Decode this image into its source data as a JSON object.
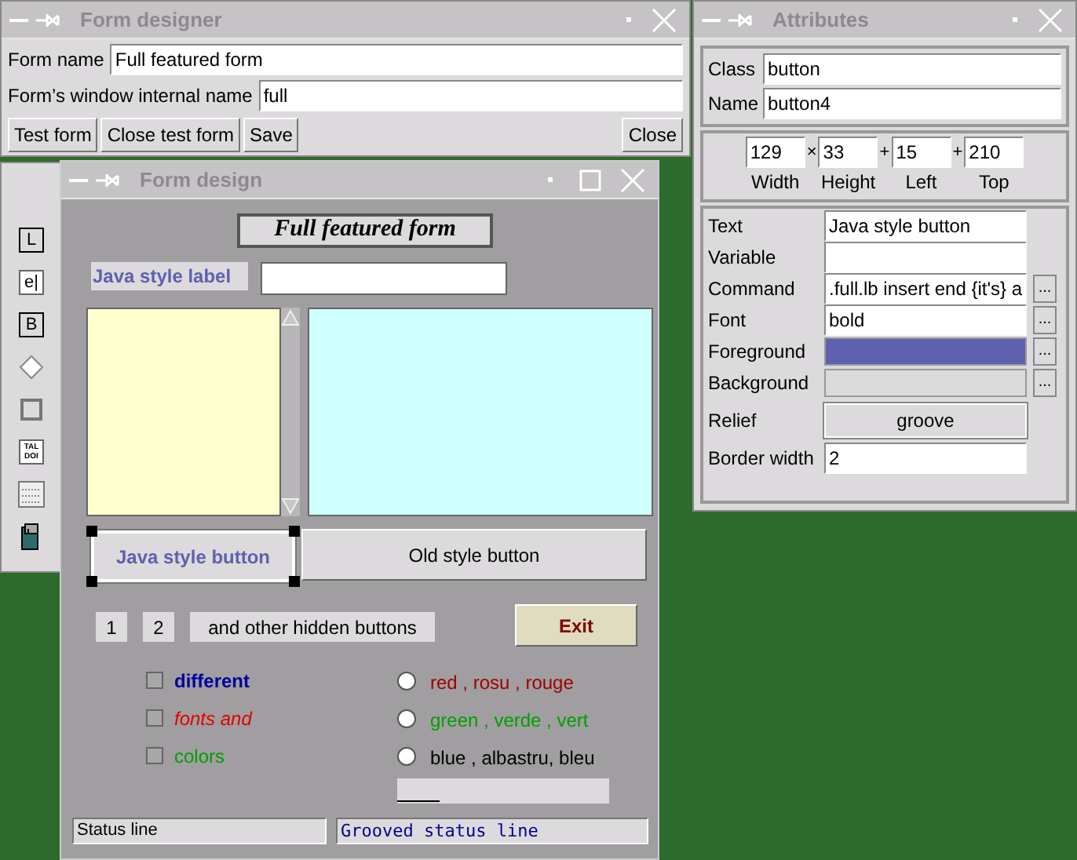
{
  "form_designer": {
    "title": "Form designer",
    "fields": [
      {
        "label": "Form name",
        "value": "Full featured form"
      },
      {
        "label": "Form’s window internal name",
        "value": "full"
      }
    ],
    "buttons": [
      "Test form",
      "Close test form",
      "Save"
    ],
    "close_button": "Close"
  },
  "attributes": {
    "title": "Attributes",
    "identity": [
      {
        "label": "Class",
        "value": "button"
      },
      {
        "label": "Name",
        "value": "button4"
      }
    ],
    "geometry": [
      {
        "value": "129",
        "label": "Width"
      },
      {
        "sep": "×",
        "value": "33",
        "label": "Height"
      },
      {
        "sep": "+",
        "value": "15",
        "label": "Left"
      },
      {
        "sep": "+",
        "value": "210",
        "label": "Top"
      }
    ],
    "properties": [
      {
        "kind": "entry",
        "label": "Text",
        "value": "Java style button"
      },
      {
        "kind": "entry",
        "label": "Variable"
      },
      {
        "kind": "entry",
        "label": "Command",
        "value": ".full.lb insert end {it's} a",
        "more": "..."
      },
      {
        "kind": "entry",
        "label": "Font",
        "value": "bold",
        "more": "..."
      },
      {
        "kind": "color",
        "label": "Foreground",
        "color": "#6060b0",
        "more": "..."
      },
      {
        "kind": "color",
        "label": "Background",
        "color": "#dcdadc",
        "more": "..."
      },
      {
        "kind": "menu",
        "label": "Relief",
        "value": "groove"
      },
      {
        "kind": "entry",
        "label": "Border width",
        "value": "2"
      }
    ]
  },
  "toolbox": {
    "items": [
      {
        "kind": "label",
        "glyph": "L"
      },
      {
        "kind": "entry",
        "glyph": "e|"
      },
      {
        "kind": "button",
        "glyph": "B"
      },
      {
        "kind": "radio"
      },
      {
        "kind": "checkbox"
      },
      {
        "kind": "text",
        "glyph": "TAL DOI"
      },
      {
        "kind": "listbox"
      },
      {
        "kind": "image"
      }
    ]
  },
  "form_design": {
    "title": "Form design",
    "heading": "Full featured form",
    "java_label": "Java style label",
    "java_button": {
      "label": "Java style button",
      "selected": true
    },
    "old_button": "Old style button",
    "small_buttons": [
      "1",
      "2",
      "and other hidden buttons"
    ],
    "exit_button": "Exit",
    "checkboxes": [
      {
        "label": "different",
        "checked": false,
        "color": "#0000a0",
        "kind": "bold"
      },
      {
        "label": "fonts and",
        "checked": false,
        "color": "#e00000",
        "kind": "italic"
      },
      {
        "label": "colors",
        "checked": false,
        "color": "#00a000",
        "kind": "plain"
      }
    ],
    "radios": [
      {
        "label": "red , rosu , rouge",
        "selected": false,
        "color": "#a00000"
      },
      {
        "label": "green , verde , vert",
        "selected": false,
        "color": "#00a000"
      },
      {
        "label": "blue , albastru, bleu",
        "selected": false,
        "color": "#000000"
      }
    ],
    "scale": {
      "level": 0.2
    },
    "status": [
      "Status line",
      "Grooved status line"
    ]
  }
}
